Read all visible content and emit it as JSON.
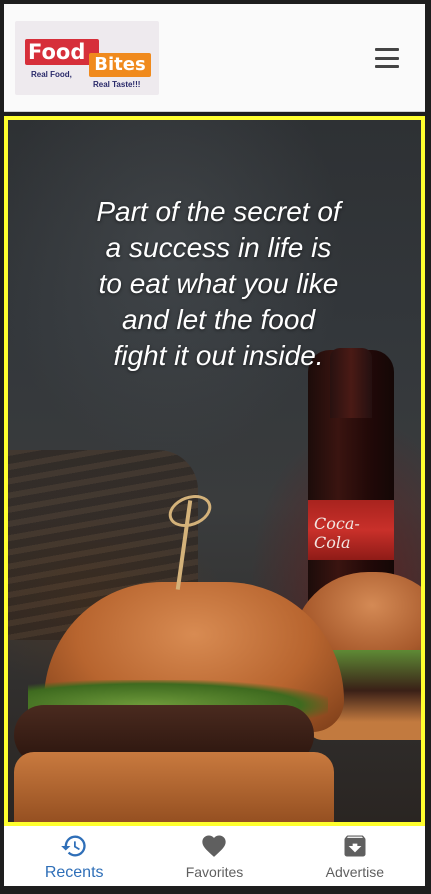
{
  "header": {
    "logo": {
      "food": "Food",
      "bites": "Bites",
      "tag_left": "Real Food,",
      "tag_right": "Real Taste!!!"
    },
    "menu_icon": "hamburger-menu-icon"
  },
  "hero": {
    "quote": "Part of the secret of a success in life is to eat what you like and let the food fight it out inside.",
    "bottle_label": "Coca-Cola",
    "border_color": "#ffff2e"
  },
  "bottom_nav": {
    "items": [
      {
        "label": "Recents",
        "icon": "history-icon",
        "active": true,
        "color": "#2f6fb8"
      },
      {
        "label": "Favorites",
        "icon": "heart-icon",
        "active": false,
        "color": "#5f5f5f"
      },
      {
        "label": "Advertise",
        "icon": "archive-icon",
        "active": false,
        "color": "#5f5f5f"
      }
    ]
  }
}
